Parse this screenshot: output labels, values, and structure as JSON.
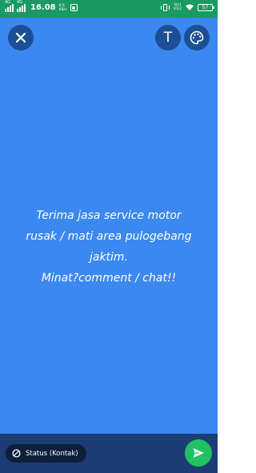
{
  "status_bar": {
    "time": "16.08",
    "net_speed_value": "0.6",
    "net_speed_unit": "KB/s",
    "sim1_label": "4G",
    "sim2_label": "4G",
    "volte_top": "Vo))",
    "volte_bottom": "LTE2",
    "battery": "57"
  },
  "toolbar": {
    "close_icon": "close-icon",
    "text_button_label": "T",
    "palette_icon": "palette-icon"
  },
  "composer": {
    "background_color": "#3b88f0",
    "lines": [
      "Terima jasa service motor",
      "rusak / mati area pulogebang",
      "jaktim.",
      "Minat?comment / chat!!"
    ]
  },
  "footer": {
    "audience_label": "Status (Kontak)",
    "audience_icon": "no-entry-icon",
    "send_icon": "send-icon",
    "send_color": "#21c063"
  }
}
